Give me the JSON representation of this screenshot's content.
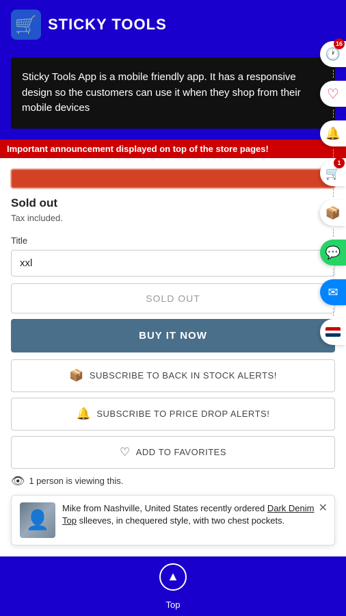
{
  "header": {
    "logo_emoji": "🛒",
    "title": "STICKY TOOLS"
  },
  "description": {
    "text": "Sticky Tools App is a mobile friendly app. It has a responsive design so the customers can use it when they shop from their mobile devices"
  },
  "announcement": {
    "text": "Important announcement displayed on top of the store pages!"
  },
  "product": {
    "sold_out_label": "Sold out",
    "tax_label": "Tax included.",
    "title_field_label": "Title",
    "title_value": "xxl",
    "btn_sold_out": "SOLD OUT",
    "btn_buy_now": "BUY IT NOW",
    "btn_subscribe_stock": "SUBSCRIBE TO BACK IN STOCK ALERTS!",
    "btn_subscribe_price": "SUBSCRIBE TO PRICE DROP ALERTS!",
    "btn_favorites": "ADD TO FAVORITES",
    "viewing_text": "1 person is viewing this.",
    "notification_name": "Mike from Nashville, United States recently ordered",
    "notification_product": "Dark Denim Top",
    "notification_suffix": "leeves, in chequered style, with two chest pockets."
  },
  "floating_icons": [
    {
      "id": "history",
      "symbol": "🕐",
      "badge": "16"
    },
    {
      "id": "heart",
      "symbol": "♡",
      "badge": null
    },
    {
      "id": "bell",
      "symbol": "🔔",
      "badge": null
    },
    {
      "id": "cart",
      "symbol": "🛒",
      "badge": "1"
    },
    {
      "id": "box",
      "symbol": "📦",
      "badge": null
    }
  ],
  "scroll_top_label": "Top",
  "colors": {
    "primary_blue": "#1a00cc",
    "dark_header": "#111111",
    "buy_button": "#4a6f8a",
    "sold_out_text": "#999999",
    "accent_red": "#cc0000"
  }
}
